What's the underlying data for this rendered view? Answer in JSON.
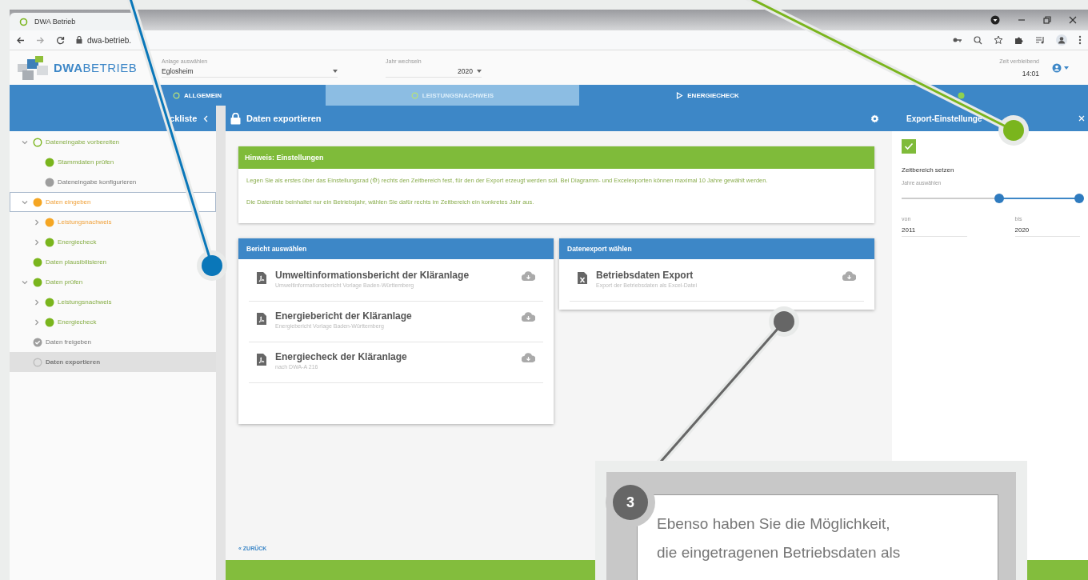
{
  "browser": {
    "tab_title": "DWA Betrieb",
    "url": "dwa-betrieb."
  },
  "header": {
    "logo_bold": "DWA",
    "logo_light": "BETRIEB",
    "plant": {
      "label": "Anlage auswählen",
      "value": "Eglosheim"
    },
    "year": {
      "label": "Jahr wechseln",
      "value": "2020"
    },
    "timer": {
      "label": "Zeit verbleibend",
      "value": "14:01"
    }
  },
  "nav_tabs": [
    {
      "label": "ALLGEMEIN",
      "selected": false
    },
    {
      "label": "LEISTUNGSNACHWEIS",
      "selected": true
    },
    {
      "label": "ENERGIECHECK",
      "selected": false
    },
    {
      "selected": false
    }
  ],
  "sidebar": {
    "title": "ckliste",
    "items": [
      {
        "label": "Dateneingabe vorbereiten",
        "kind": "pending",
        "selected": false,
        "focused": false,
        "expanded": true,
        "children": [
          {
            "label": "Stammdaten prüfen",
            "kind": "done",
            "selected": false,
            "focused": false
          },
          {
            "label": "Dateneingabe konfigurieren",
            "kind": "open",
            "selected": false,
            "focused": false
          }
        ]
      },
      {
        "label": "Daten eingeben",
        "kind": "active",
        "selected": false,
        "focused": true,
        "expanded": true,
        "children": [
          {
            "label": "Leistungsnachweis",
            "kind": "active",
            "selected": false,
            "focused": false,
            "expanded": false
          },
          {
            "label": "Energiecheck",
            "kind": "done",
            "selected": false,
            "focused": false,
            "expanded": false
          }
        ]
      },
      {
        "label": "Daten plausibilisieren",
        "kind": "done",
        "selected": false,
        "focused": false
      },
      {
        "label": "Daten prüfen",
        "kind": "done",
        "selected": false,
        "focused": false,
        "expanded": true,
        "children": [
          {
            "label": "Leistungsnachweis",
            "kind": "done",
            "selected": false,
            "focused": false,
            "expanded": false
          },
          {
            "label": "Energiecheck",
            "kind": "done",
            "selected": false,
            "focused": false,
            "expanded": false
          }
        ]
      },
      {
        "label": "Daten freigeben",
        "kind": "approved",
        "selected": false,
        "focused": false
      },
      {
        "label": "Daten exportieren",
        "kind": "empty",
        "selected": true,
        "focused": false
      }
    ]
  },
  "main": {
    "title": "Daten exportieren",
    "notice": {
      "title": "Hinweis: Einstellungen",
      "paragraphs": [
        "Legen Sie als erstes über das Einstellungsrad (⚙) rechts den Zeitbereich fest, für den der Export erzeugt werden soll. Bei Diagramm- und Excelexporten können maximal 10 Jahre gewählt werden.",
        "Die Datenliste beinhaltet nur ein Betriebsjahr, wählen Sie dafür rechts im Zeitbereich ein konkretes Jahr aus."
      ]
    },
    "cards": [
      {
        "title": "Bericht auswählen",
        "items": [
          {
            "title": "Umweltinformationsbericht der Kläranlage",
            "subtitle": "Umweltinformationsbericht Vorlage Baden-Württemberg",
            "kind": "pdf"
          },
          {
            "title": "Energiebericht der Kläranlage",
            "subtitle": "Energiebericht Vorlage Baden-Württemberg",
            "kind": "pdf"
          },
          {
            "title": "Energiecheck der Kläranlage",
            "subtitle": "nach DWA-A 216",
            "kind": "pdf"
          }
        ]
      },
      {
        "title": "Datenexport wählen",
        "items": [
          {
            "title": "Betriebsdaten Export",
            "subtitle": "Export der Betriebsdaten als Excel-Datei",
            "kind": "excel"
          }
        ]
      }
    ],
    "back": "« ZURÜCK"
  },
  "export_panel": {
    "title": "Export-Einstellunge",
    "checked": true,
    "section": "Zeitbereich setzen",
    "slider_label": "Jahre auswählen",
    "thumbs": [
      {
        "level": 0.55
      },
      {
        "level": 1
      }
    ],
    "from": {
      "label": "von",
      "value": "2011"
    },
    "to": {
      "label": "bis",
      "value": "2020"
    }
  },
  "pointers": [
    {
      "color": "#0a77b9"
    },
    {
      "color": "#7ab51d"
    },
    {
      "color": "#666666"
    }
  ],
  "callout": {
    "number": "3",
    "text": "Ebenso haben Sie die Möglichkeit,\ndie eingetragenen Betriebsdaten als"
  }
}
